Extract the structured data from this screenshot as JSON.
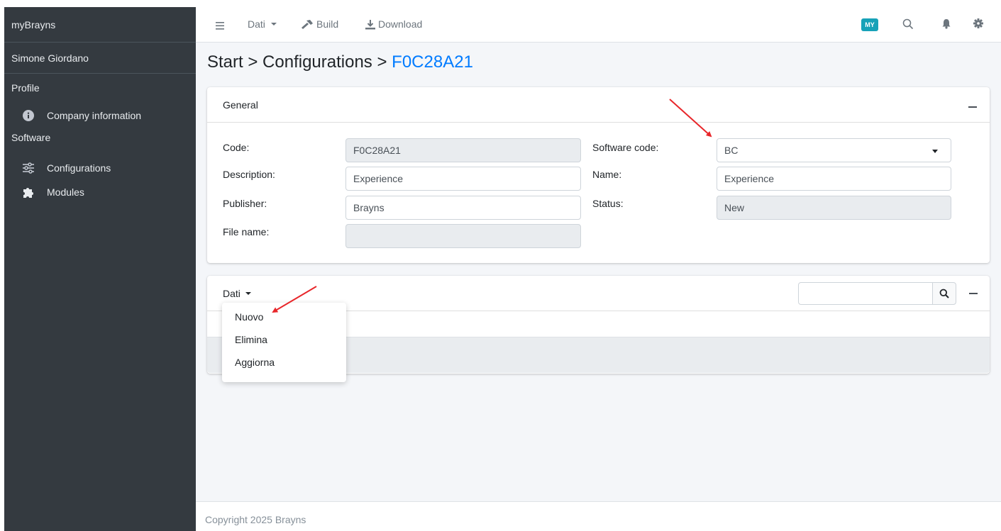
{
  "sidebar": {
    "brand": "myBrayns",
    "user": "Simone Giordano",
    "sections": [
      {
        "header": "Profile",
        "items": [
          {
            "label": "Company information",
            "icon": "info-circle-icon"
          }
        ]
      },
      {
        "header": "Software",
        "items": [
          {
            "label": "Configurations",
            "icon": "sliders-icon"
          },
          {
            "label": "Modules",
            "icon": "puzzle-icon"
          }
        ]
      }
    ]
  },
  "topbar": {
    "dati_label": "Dati",
    "build_label": "Build",
    "download_label": "Download",
    "badge_label": "MY",
    "badge_color": "#17a2b8"
  },
  "breadcrumb": {
    "part1": "Start",
    "sep": ">",
    "part2": "Configurations",
    "current": "F0C28A21"
  },
  "general": {
    "title": "General",
    "code_label": "Code:",
    "code_value": "F0C28A21",
    "description_label": "Description:",
    "description_value": "Experience",
    "publisher_label": "Publisher:",
    "publisher_value": "Brayns",
    "filename_label": "File name:",
    "filename_value": "",
    "software_code_label": "Software code:",
    "software_code_value": "BC",
    "name_label": "Name:",
    "name_value": "Experience",
    "status_label": "Status:",
    "status_value": "New"
  },
  "dati_card": {
    "menu_label": "Dati",
    "search_value": "",
    "dropdown_items": [
      "Nuovo",
      "Elimina",
      "Aggiorna"
    ]
  },
  "footer": {
    "text": "Copyright 2025 Brayns"
  },
  "colors": {
    "sidebar_bg": "#343a40",
    "link_blue": "#007bff",
    "arrow_red": "#e8262a"
  }
}
